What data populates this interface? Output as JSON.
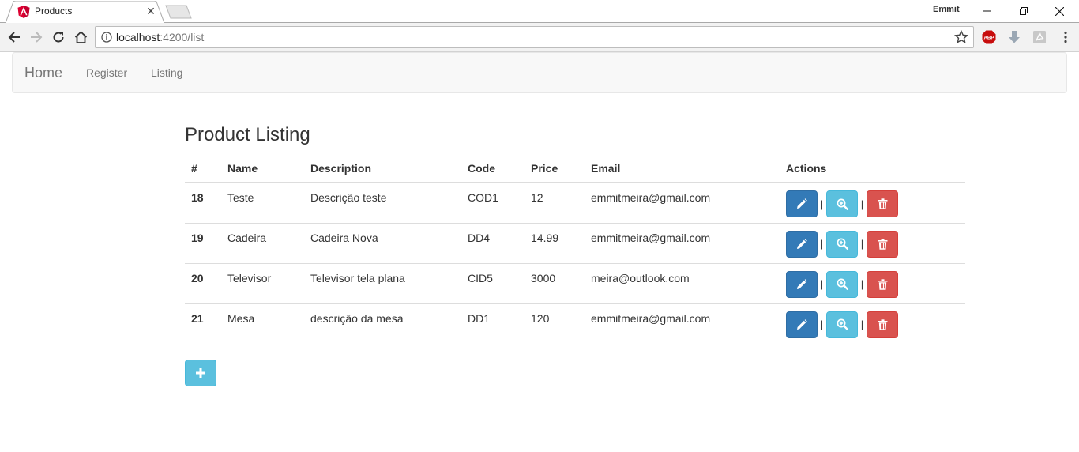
{
  "browser": {
    "tab_title": "Products",
    "profile_name": "Emmit",
    "url_host": "localhost",
    "url_path": ":4200/list"
  },
  "navbar": {
    "brand": "Home",
    "links": [
      "Register",
      "Listing"
    ]
  },
  "page": {
    "title": "Product Listing",
    "columns": [
      "#",
      "Name",
      "Description",
      "Code",
      "Price",
      "Email",
      "Actions"
    ],
    "rows": [
      {
        "id": "18",
        "name": "Teste",
        "description": "Descrição teste",
        "code": "COD1",
        "price": "12",
        "email": "emmitmeira@gmail.com"
      },
      {
        "id": "19",
        "name": "Cadeira",
        "description": "Cadeira Nova",
        "code": "DD4",
        "price": "14.99",
        "email": "emmitmeira@gmail.com"
      },
      {
        "id": "20",
        "name": "Televisor",
        "description": "Televisor tela plana",
        "code": "CID5",
        "price": "3000",
        "email": "meira@outlook.com"
      },
      {
        "id": "21",
        "name": "Mesa",
        "description": "descrição da mesa",
        "code": "DD1",
        "price": "120",
        "email": "emmitmeira@gmail.com"
      }
    ],
    "action_separator": "|",
    "action_icons": [
      "pencil-icon",
      "zoom-in-icon",
      "trash-icon"
    ],
    "add_icon": "plus-icon"
  },
  "colors": {
    "primary": "#337ab7",
    "info": "#5bc0de",
    "danger": "#d9534f"
  }
}
